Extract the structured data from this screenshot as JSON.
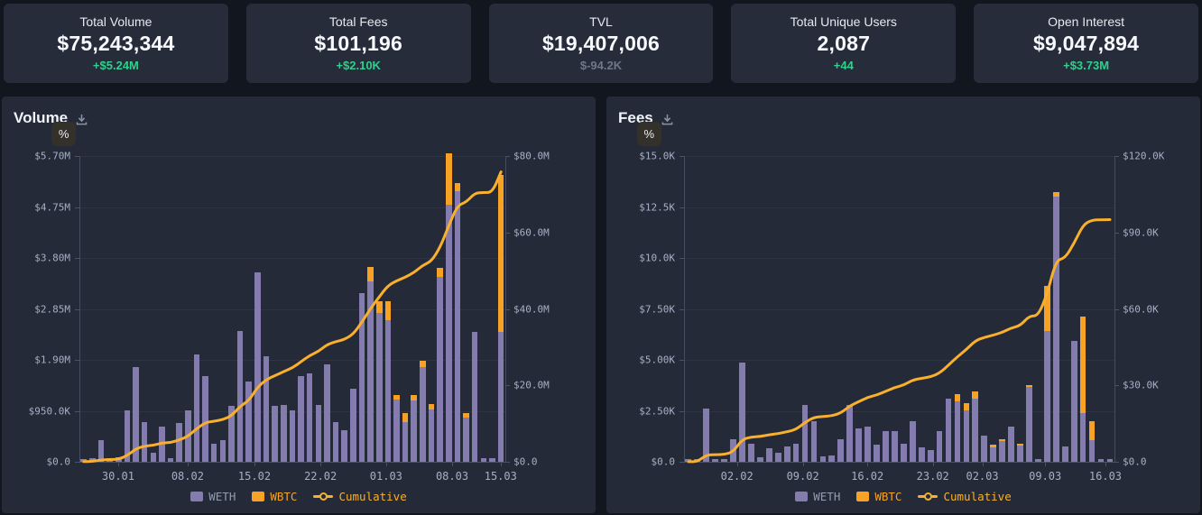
{
  "page": {
    "background": "#12161f"
  },
  "colors": {
    "weth": "#847cae",
    "wbtc": "#f7a225",
    "cumulative": "#f9b02e",
    "positive": "#2fd18c",
    "muted": "#6f7789",
    "panel_bg": "#242a37",
    "card_bg": "#262c3a"
  },
  "cards": [
    {
      "label": "Total Volume",
      "value": "$75,243,344",
      "delta": "+$5.24M",
      "delta_type": "positive"
    },
    {
      "label": "Total Fees",
      "value": "$101,196",
      "delta": "+$2.10K",
      "delta_type": "positive"
    },
    {
      "label": "TVL",
      "value": "$19,407,006",
      "delta": "$-94.2K",
      "delta_type": "muted"
    },
    {
      "label": "Total Unique Users",
      "value": "2,087",
      "delta": "+44",
      "delta_type": "positive"
    },
    {
      "label": "Open Interest",
      "value": "$9,047,894",
      "delta": "+$3.73M",
      "delta_type": "positive"
    }
  ],
  "chart_data": [
    {
      "type": "bar",
      "title": "Volume",
      "percent_label": "%",
      "bars_unit": "USD thousands per day (stacked WETH+WBTC, left axis)",
      "cumulative": "running total of daily bars, right axis",
      "legend": [
        "WETH",
        "WBTC",
        "Cumulative"
      ],
      "y_axis_left": {
        "labels": [
          "$5.70M",
          "$4.75M",
          "$3.80M",
          "$2.85M",
          "$1.90M",
          "$950.0K",
          "$0.0"
        ],
        "max": 5700
      },
      "y_axis_right": {
        "labels": [
          "$80.0M",
          "$60.0M",
          "$40.0M",
          "$20.0M",
          "$0.0"
        ],
        "max": 80000
      },
      "x_ticks": [
        {
          "label": "30.01",
          "pos": 0.091
        },
        {
          "label": "08.02",
          "pos": 0.254
        },
        {
          "label": "15.02",
          "pos": 0.411
        },
        {
          "label": "22.02",
          "pos": 0.566
        },
        {
          "label": "01.03",
          "pos": 0.72
        },
        {
          "label": "08.03",
          "pos": 0.875
        },
        {
          "label": "15.03",
          "pos": 0.989
        }
      ],
      "bar_fields": [
        "date",
        "weth",
        "wbtc"
      ],
      "bars": [
        [
          "26.01",
          40,
          0
        ],
        [
          "27.01",
          60,
          0
        ],
        [
          "28.01",
          400,
          0
        ],
        [
          "29.01",
          70,
          0
        ],
        [
          "30.01",
          90,
          0
        ],
        [
          "31.01",
          960,
          0
        ],
        [
          "01.02",
          1770,
          0
        ],
        [
          "02.02",
          740,
          0
        ],
        [
          "03.02",
          170,
          0
        ],
        [
          "04.02",
          650,
          0
        ],
        [
          "05.02",
          60,
          0
        ],
        [
          "06.02",
          720,
          0
        ],
        [
          "07.02",
          960,
          0
        ],
        [
          "08.02",
          2000,
          0
        ],
        [
          "09.02",
          1600,
          0
        ],
        [
          "10.02",
          340,
          0
        ],
        [
          "11.02",
          400,
          0
        ],
        [
          "12.02",
          1040,
          0
        ],
        [
          "13.02",
          2440,
          0
        ],
        [
          "14.02",
          1500,
          0
        ],
        [
          "15.02",
          3530,
          0
        ],
        [
          "16.02",
          1970,
          0
        ],
        [
          "17.02",
          1040,
          0
        ],
        [
          "18.02",
          1060,
          0
        ],
        [
          "19.02",
          960,
          0
        ],
        [
          "20.02",
          1600,
          0
        ],
        [
          "21.02",
          1650,
          0
        ],
        [
          "22.02",
          1060,
          0
        ],
        [
          "23.02",
          1810,
          0
        ],
        [
          "24.02",
          740,
          0
        ],
        [
          "25.02",
          590,
          0
        ],
        [
          "26.02",
          1360,
          0
        ],
        [
          "27.02",
          3140,
          0
        ],
        [
          "28.02",
          3360,
          270
        ],
        [
          "01.03",
          2770,
          230
        ],
        [
          "02.03",
          2640,
          350
        ],
        [
          "03.03",
          1160,
          80
        ],
        [
          "04.03",
          740,
          170
        ],
        [
          "05.03",
          1140,
          100
        ],
        [
          "06.03",
          1760,
          120
        ],
        [
          "07.03",
          970,
          100
        ],
        [
          "08.03",
          3450,
          170
        ],
        [
          "09.03",
          4790,
          960
        ],
        [
          "10.03",
          5040,
          150
        ],
        [
          "11.03",
          820,
          80
        ],
        [
          "12.03",
          2420,
          0
        ],
        [
          "13.03",
          70,
          0
        ],
        [
          "14.03",
          60,
          0
        ],
        [
          "15.03",
          2420,
          2930
        ]
      ]
    },
    {
      "type": "bar",
      "title": "Fees",
      "percent_label": "%",
      "bars_unit": "USD per day (stacked WETH+WBTC, left axis)",
      "cumulative": "running total of daily bars, right axis",
      "legend": [
        "WETH",
        "WBTC",
        "Cumulative"
      ],
      "y_axis_left": {
        "labels": [
          "$15.0K",
          "$12.5K",
          "$10.0K",
          "$7.50K",
          "$5.00K",
          "$2.50K",
          "$0.0"
        ],
        "max": 15000
      },
      "y_axis_right": {
        "labels": [
          "$120.0K",
          "$90.0K",
          "$60.0K",
          "$30.0K",
          "$0.0"
        ],
        "max": 120000
      },
      "x_ticks": [
        {
          "label": "02.02",
          "pos": 0.123
        },
        {
          "label": "09.02",
          "pos": 0.276
        },
        {
          "label": "16.02",
          "pos": 0.426
        },
        {
          "label": "23.02",
          "pos": 0.578
        },
        {
          "label": "02.03",
          "pos": 0.693
        },
        {
          "label": "09.03",
          "pos": 0.839
        },
        {
          "label": "16.03",
          "pos": 0.979
        }
      ],
      "bar_fields": [
        "date",
        "weth",
        "wbtc"
      ],
      "bars": [
        [
          "28.01",
          20,
          0
        ],
        [
          "29.01",
          40,
          0
        ],
        [
          "30.01",
          2610,
          0
        ],
        [
          "31.01",
          100,
          0
        ],
        [
          "01.02",
          90,
          0
        ],
        [
          "02.02",
          1110,
          0
        ],
        [
          "03.02",
          4870,
          0
        ],
        [
          "04.02",
          870,
          0
        ],
        [
          "05.02",
          200,
          0
        ],
        [
          "06.02",
          680,
          0
        ],
        [
          "07.02",
          460,
          0
        ],
        [
          "08.02",
          750,
          0
        ],
        [
          "09.02",
          900,
          0
        ],
        [
          "10.02",
          2790,
          0
        ],
        [
          "11.02",
          2000,
          0
        ],
        [
          "12.02",
          280,
          0
        ],
        [
          "13.02",
          300,
          0
        ],
        [
          "14.02",
          1110,
          0
        ],
        [
          "15.02",
          2790,
          0
        ],
        [
          "16.02",
          1640,
          0
        ],
        [
          "17.02",
          1730,
          0
        ],
        [
          "18.02",
          840,
          0
        ],
        [
          "19.02",
          1500,
          0
        ],
        [
          "20.02",
          1510,
          0
        ],
        [
          "21.02",
          890,
          0
        ],
        [
          "22.02",
          1990,
          0
        ],
        [
          "23.02",
          700,
          0
        ],
        [
          "24.02",
          580,
          0
        ],
        [
          "25.02",
          1500,
          0
        ],
        [
          "26.02",
          3100,
          0
        ],
        [
          "27.02",
          2970,
          330
        ],
        [
          "28.02",
          2520,
          350
        ],
        [
          "01.03",
          3100,
          350
        ],
        [
          "02.03",
          1280,
          0
        ],
        [
          "03.03",
          700,
          150
        ],
        [
          "04.03",
          1000,
          110
        ],
        [
          "05.03",
          1730,
          0
        ],
        [
          "06.03",
          800,
          100
        ],
        [
          "07.03",
          3660,
          120
        ],
        [
          "08.03",
          90,
          0
        ],
        [
          "09.03",
          6420,
          2200
        ],
        [
          "10.03",
          13000,
          210
        ],
        [
          "11.03",
          750,
          0
        ],
        [
          "12.03",
          5930,
          0
        ],
        [
          "13.03",
          2390,
          4740
        ],
        [
          "14.03",
          1070,
          930
        ],
        [
          "15.03",
          50,
          0
        ],
        [
          "16.03",
          30,
          0
        ]
      ]
    }
  ]
}
